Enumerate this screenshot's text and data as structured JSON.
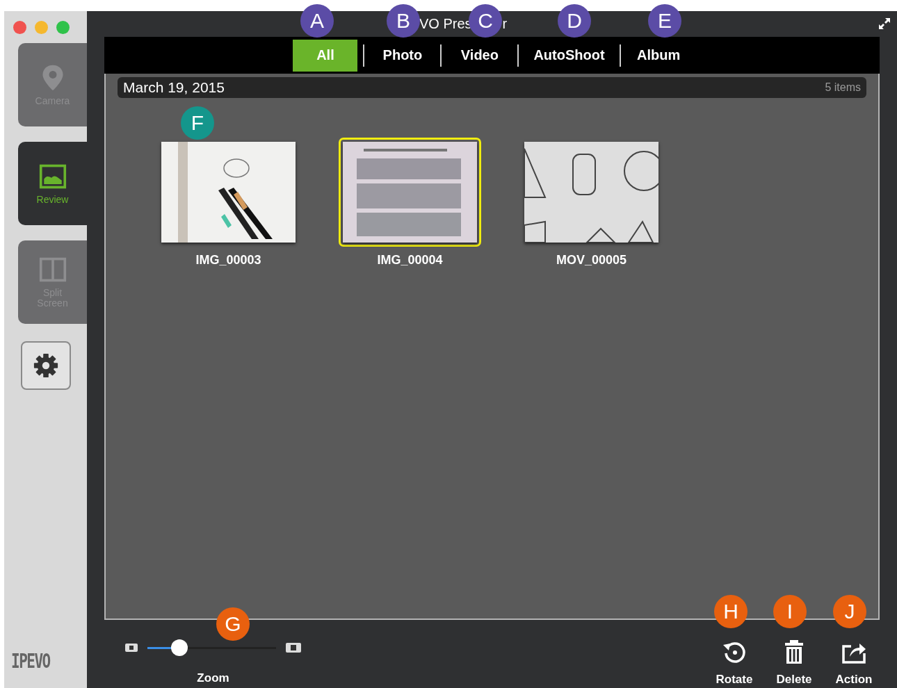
{
  "window": {
    "title_parts": [
      "VO Pres",
      "r"
    ]
  },
  "sidebar": {
    "items": [
      {
        "label_lines": [
          "Camera"
        ],
        "selected": false
      },
      {
        "label_lines": [
          "Review"
        ],
        "selected": true
      },
      {
        "label_lines": [
          "Split",
          "Screen"
        ],
        "selected": false
      }
    ],
    "logo": "IPEVO"
  },
  "tabs": [
    {
      "label": "All",
      "selected": true
    },
    {
      "label": "Photo",
      "selected": false
    },
    {
      "label": "Video",
      "selected": false
    },
    {
      "label": "AutoShoot",
      "selected": false
    },
    {
      "label": "Album",
      "selected": false
    }
  ],
  "group": {
    "date": "March 19, 2015",
    "count": "5 items"
  },
  "thumbnails": [
    {
      "name": "IMG_00003",
      "selected": false,
      "kind": "picture"
    },
    {
      "name": "IMG_00004",
      "selected": true,
      "kind": "picture"
    },
    {
      "name": "MOV_00005",
      "selected": false,
      "kind": "picture"
    }
  ],
  "zoom": {
    "label": "Zoom",
    "level": 0.22
  },
  "actions": [
    {
      "label": "Rotate"
    },
    {
      "label": "Delete"
    },
    {
      "label": "Action"
    }
  ],
  "callouts": [
    {
      "label": "A",
      "color": "#5b4ca6"
    },
    {
      "label": "B",
      "color": "#5b4ca6"
    },
    {
      "label": "C",
      "color": "#5b4ca6"
    },
    {
      "label": "D",
      "color": "#5b4ca6"
    },
    {
      "label": "E",
      "color": "#5b4ca6"
    },
    {
      "label": "F",
      "color": "#14968c"
    },
    {
      "label": "G",
      "color": "#e8600f"
    },
    {
      "label": "H",
      "color": "#e8600f"
    },
    {
      "label": "I",
      "color": "#e8600f"
    },
    {
      "label": "J",
      "color": "#e8600f"
    }
  ]
}
